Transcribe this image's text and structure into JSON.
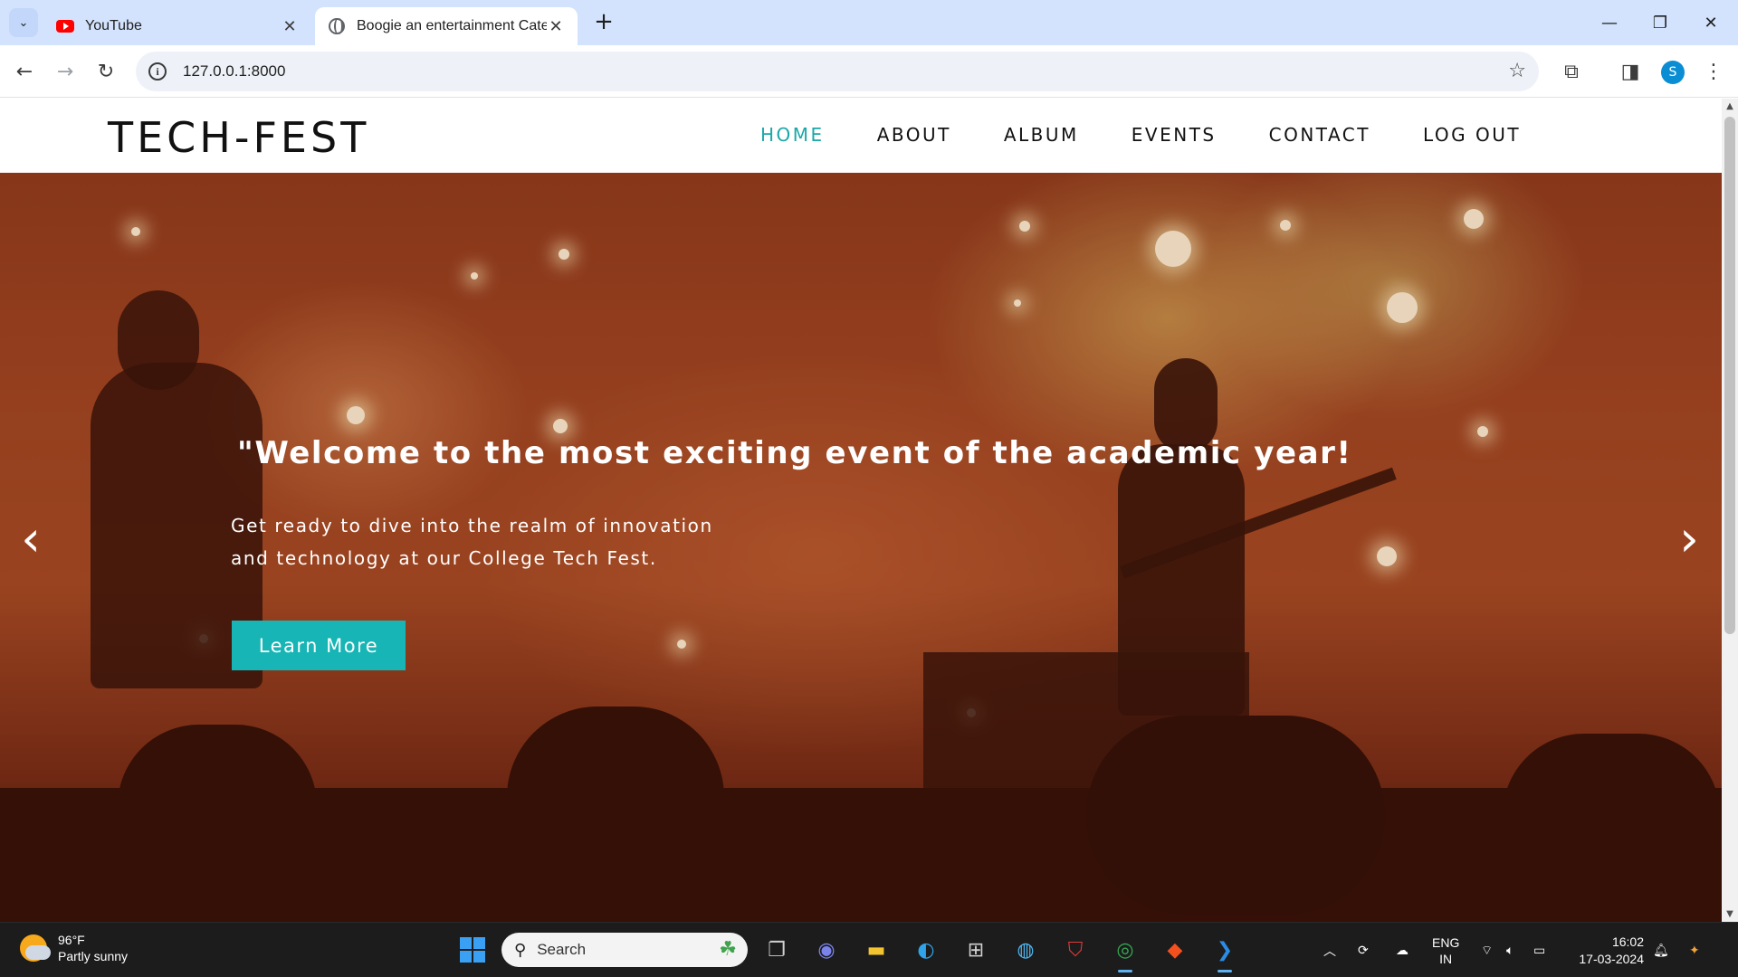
{
  "browser": {
    "tabs": [
      {
        "title": "YouTube",
        "favicon": "youtube-icon",
        "active": false
      },
      {
        "title": "Boogie an entertainment Categ",
        "favicon": "globe-icon",
        "active": true
      }
    ],
    "address": "127.0.0.1:8000",
    "profile_initial": "S"
  },
  "site": {
    "brand": "TECH-FEST",
    "nav": [
      "HOME",
      "ABOUT",
      "ALBUM",
      "EVENTS",
      "CONTACT",
      "LOG OUT"
    ],
    "active_nav": "HOME",
    "accent_color": "#1aa8a8"
  },
  "hero": {
    "title": "\"Welcome to the most exciting event of the academic year!",
    "subtitle_line1": "Get ready to dive into the realm of innovation",
    "subtitle_line2": "and technology at our College Tech Fest.",
    "cta_label": "Learn More",
    "cta_color": "#17b5b5",
    "prev_icon": "chevron-left-icon",
    "next_icon": "chevron-right-icon"
  },
  "taskbar": {
    "weather_temp": "96°F",
    "weather_desc": "Partly sunny",
    "search_label": "Search",
    "lang_line1": "ENG",
    "lang_line2": "IN",
    "time": "16:02",
    "date": "17-03-2024"
  }
}
